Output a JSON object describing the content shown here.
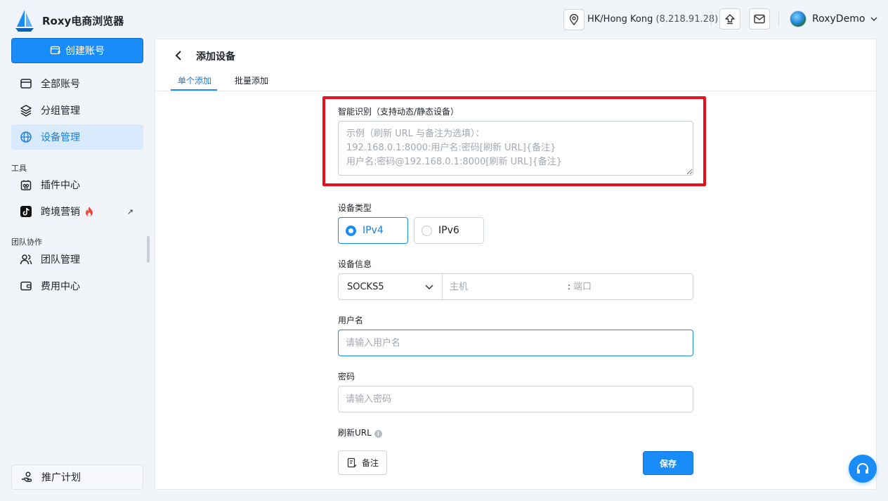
{
  "app": {
    "name": "Roxy电商浏览器"
  },
  "sidebar": {
    "create_button": "创建账号",
    "items": [
      {
        "label": "全部账号",
        "icon": "window-icon"
      },
      {
        "label": "分组管理",
        "icon": "layers-icon"
      },
      {
        "label": "设备管理",
        "icon": "globe-icon",
        "active": true
      }
    ],
    "tools_section": "工具",
    "tools": [
      {
        "label": "插件中心",
        "icon": "plugin-icon"
      },
      {
        "label": "跨境营销",
        "icon": "tiktok-icon",
        "badge": "fire-icon",
        "external": "↗"
      }
    ],
    "team_section": "团队协作",
    "team": [
      {
        "label": "团队管理",
        "icon": "users-icon"
      },
      {
        "label": "费用中心",
        "icon": "wallet-icon"
      }
    ],
    "promo": {
      "label": "推广计划",
      "icon": "handshake-icon"
    }
  },
  "topbar": {
    "location": "HK/Hong Kong",
    "ip": "(8.218.91.28)",
    "user": "RoxyDemo"
  },
  "page": {
    "title": "添加设备",
    "tabs": [
      "单个添加",
      "批量添加"
    ],
    "active_tab": 0
  },
  "form": {
    "smart_label": "智能识别（支持动态/静态设备）",
    "smart_placeholder": "示例（刷新 URL 与备注为选填）：\n192.168.0.1:8000:用户名:密码[刷新 URL]{备注}\n用户名:密码@192.168.0.1:8000[刷新 URL]{备注}",
    "type_label": "设备类型",
    "type_options": [
      "IPv4",
      "IPv6"
    ],
    "type_selected": "IPv4",
    "info_label": "设备信息",
    "protocol": "SOCKS5",
    "host_placeholder": "主机",
    "port_separator": ":",
    "port_placeholder": "端口",
    "username_label": "用户名",
    "username_placeholder": "请输入用户名",
    "password_label": "密码",
    "password_placeholder": "请输入密码",
    "refresh_label": "刷新URL",
    "note_button": "备注",
    "save_button": "保存"
  },
  "colors": {
    "accent": "#1a8cf7",
    "highlight_border": "#e8101d",
    "active_nav_bg": "#d8eafc"
  }
}
